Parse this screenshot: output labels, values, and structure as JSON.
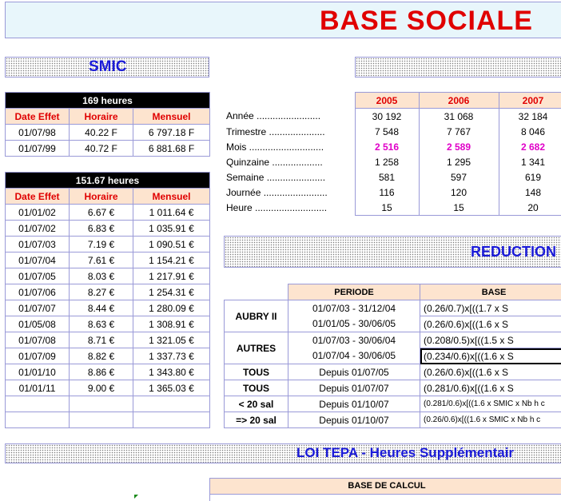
{
  "title": "BASE SOCIALE",
  "smic_section": {
    "title": "SMIC"
  },
  "table169": {
    "title": "169 heures",
    "headers": [
      "Date Effet",
      "Horaire",
      "Mensuel"
    ],
    "rows": [
      [
        "01/07/98",
        "40.22 F",
        "6 797.18 F"
      ],
      [
        "01/07/99",
        "40.72 F",
        "6 881.68 F"
      ]
    ]
  },
  "table151": {
    "title": "151.67 heures",
    "headers": [
      "Date Effet",
      "Horaire",
      "Mensuel"
    ],
    "rows": [
      [
        "01/01/02",
        "6.67 €",
        "1 011.64 €"
      ],
      [
        "01/07/02",
        "6.83 €",
        "1 035.91 €"
      ],
      [
        "01/07/03",
        "7.19 €",
        "1 090.51 €"
      ],
      [
        "01/07/04",
        "7.61 €",
        "1 154.21 €"
      ],
      [
        "01/07/05",
        "8.03 €",
        "1 217.91 €"
      ],
      [
        "01/07/06",
        "8.27 €",
        "1 254.31 €"
      ],
      [
        "01/07/07",
        "8.44 €",
        "1 280.09 €"
      ],
      [
        "01/05/08",
        "8.63 €",
        "1 308.91 €"
      ],
      [
        "01/07/08",
        "8.71 €",
        "1 321.05 €"
      ],
      [
        "01/07/09",
        "8.82 €",
        "1 337.73 €"
      ],
      [
        "01/01/10",
        "8.86 €",
        "1 343.80 €"
      ],
      [
        "01/01/11",
        "9.00 €",
        "1 365.03 €"
      ],
      [
        "",
        "",
        ""
      ],
      [
        "",
        "",
        ""
      ]
    ]
  },
  "plafond": {
    "years": [
      "2005",
      "2006",
      "2007"
    ],
    "rows": [
      {
        "label": "Année ........................",
        "values": [
          "30 192",
          "31 068",
          "32 184"
        ],
        "highlight": false
      },
      {
        "label": "Trimestre .....................",
        "values": [
          "7 548",
          "7 767",
          "8 046"
        ],
        "highlight": false
      },
      {
        "label": "Mois ............................",
        "values": [
          "2 516",
          "2 589",
          "2 682"
        ],
        "highlight": true
      },
      {
        "label": "Quinzaine ...................",
        "values": [
          "1 258",
          "1 295",
          "1 341"
        ],
        "highlight": false
      },
      {
        "label": "Semaine ......................",
        "values": [
          "581",
          "597",
          "619"
        ],
        "highlight": false
      },
      {
        "label": "Journée ........................",
        "values": [
          "116",
          "120",
          "148"
        ],
        "highlight": false
      },
      {
        "label": "Heure ...........................",
        "values": [
          "15",
          "15",
          "20"
        ],
        "highlight": false
      }
    ]
  },
  "reduction": {
    "title": "REDUCTION",
    "headers": [
      "PERIODE",
      "BASE"
    ],
    "groups": [
      {
        "name": "AUBRY II",
        "rows": [
          [
            "01/07/03 - 31/12/04",
            "(0.26/0.7)x[((1.7 x S"
          ],
          [
            "01/01/05 - 30/06/05",
            "(0.26/0.6)x[((1.6 x S"
          ]
        ]
      },
      {
        "name": "AUTRES",
        "rows": [
          [
            "01/07/03 - 30/06/04",
            "(0.208/0.5)x[((1.5 x S"
          ],
          [
            "01/07/04 - 30/06/05",
            "(0.234/0.6)x[((1.6 x S"
          ]
        ]
      },
      {
        "name": "TOUS",
        "rows": [
          [
            "Depuis 01/07/05",
            "(0.26/0.6)x[((1.6 x S"
          ]
        ]
      },
      {
        "name": "TOUS",
        "rows": [
          [
            "Depuis 01/07/07",
            "(0.281/0.6)x[((1.6 x S"
          ]
        ]
      },
      {
        "name": "< 20 sal",
        "rows": [
          [
            "Depuis 01/10/07",
            "(0.281/0.6)x[((1.6 x SMIC x Nb h c"
          ]
        ]
      },
      {
        "name": "=> 20 sal",
        "rows": [
          [
            "Depuis 01/10/07",
            "(0.26/0.6)x[((1.6 x SMIC x Nb h c"
          ]
        ]
      }
    ]
  },
  "tepa": {
    "title": "LOI TEPA - Heures Supplémentair",
    "base_header": "BASE DE CALCUL"
  }
}
